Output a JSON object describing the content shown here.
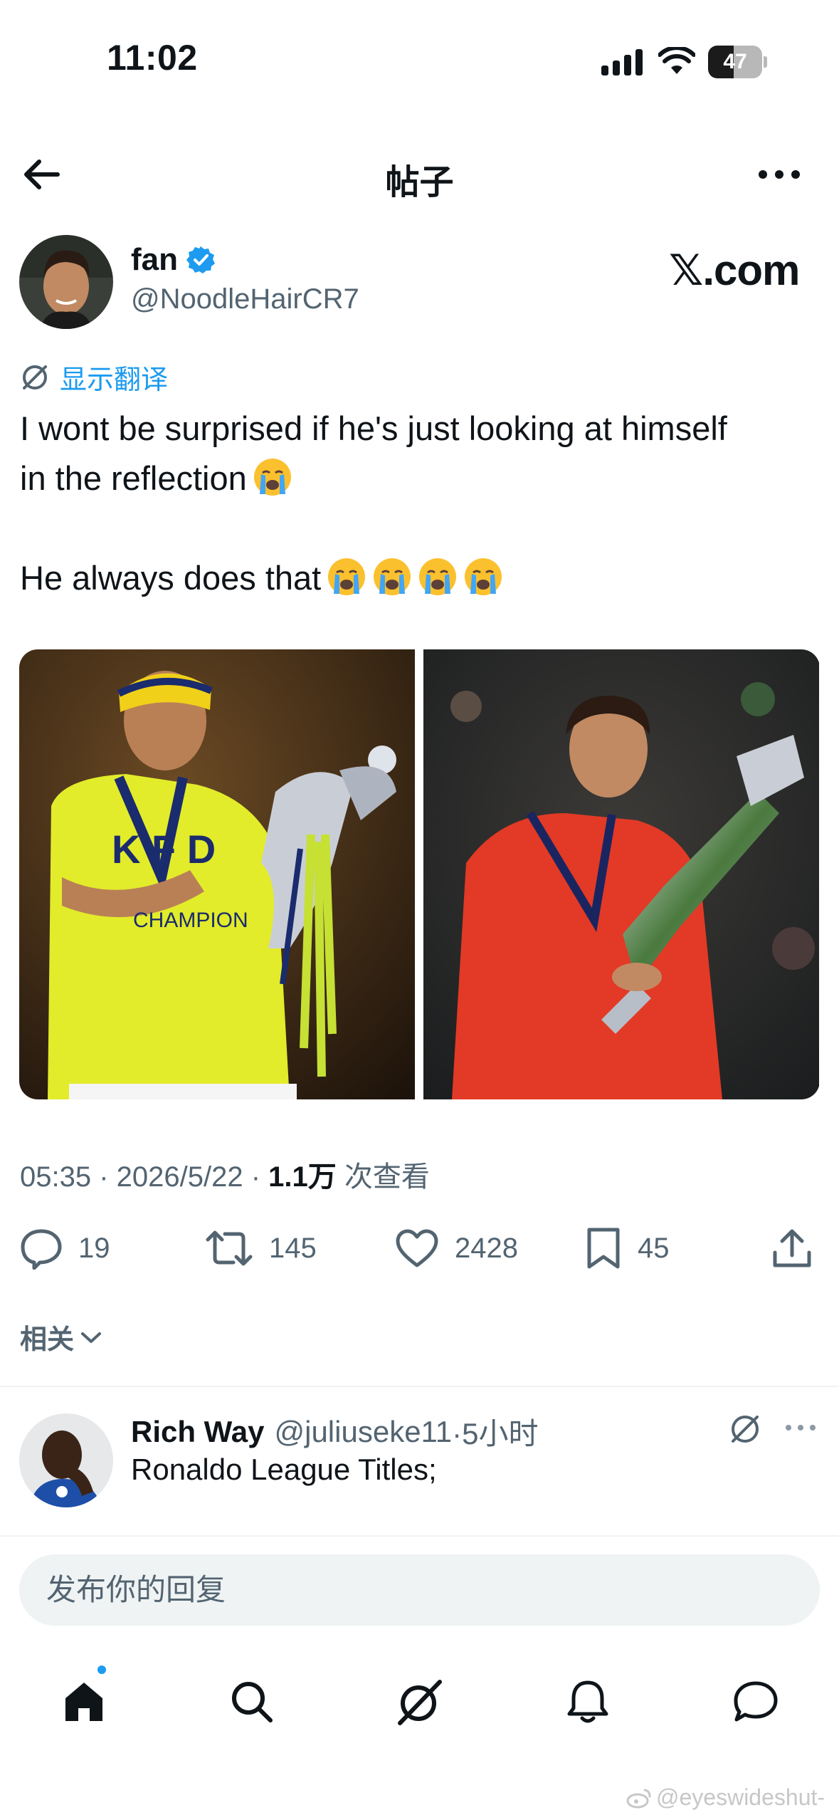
{
  "status_bar": {
    "time": "11:02",
    "battery": "47",
    "battery_level": 0.47
  },
  "nav": {
    "title": "帖子",
    "back_icon": "arrow-left-icon",
    "more_icon": "more-horizontal-icon"
  },
  "post": {
    "author_name": "fan",
    "author_handle": "@NoodleHairCR7",
    "verified": true,
    "source_badge": "𝕏.com",
    "translate_label": "显示翻译",
    "text_line1": "I wont be surprised if he's just looking at himself",
    "text_line2": "in the reflection",
    "text_line3": "He always does that",
    "emoji": "loudly-crying-face-emoji",
    "media_icons": [
      "photo-player-yellow-kit-trophy",
      "photo-player-red-kit-trophy"
    ],
    "timestamp": "05:35 · 2026/5/22 · ",
    "views_count": "1.1万",
    "views_label": " 次查看"
  },
  "actions": {
    "replies": "19",
    "reposts": "145",
    "likes": "2428",
    "bookmarks": "45"
  },
  "related_label": "相关",
  "reply": {
    "name": "Rich Way",
    "handle": "@juliuseke11",
    "time": "·5小时",
    "text": "Ronaldo League Titles;"
  },
  "composer": {
    "placeholder": "发布你的回复"
  },
  "tabbar": {
    "items": [
      "home-icon",
      "search-icon",
      "grok-icon",
      "notifications-icon",
      "messages-icon"
    ]
  },
  "watermark": "@eyeswideshut-",
  "colors": {
    "accent": "#1d9bf0",
    "secondary_text": "#536471",
    "primary_text": "#0f1419",
    "divider": "#eff3f4"
  }
}
